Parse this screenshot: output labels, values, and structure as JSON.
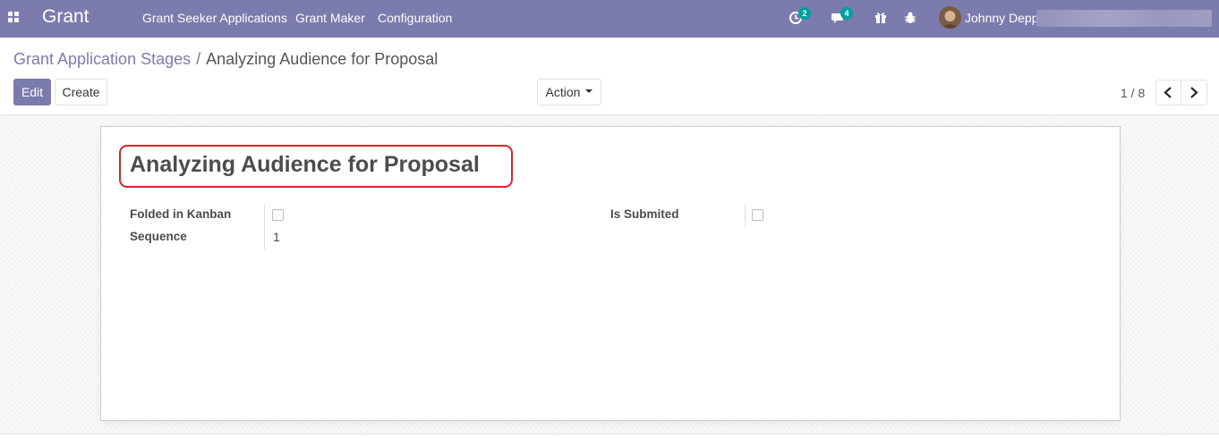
{
  "navbar": {
    "brand": "Grant",
    "menu": [
      "Grant Seeker Applications",
      "Grant Maker",
      "Configuration"
    ],
    "activity_count": "2",
    "messages_count": "4",
    "user_name": "Johnny Depp",
    "color": "#7c7bad"
  },
  "breadcrumb": {
    "parent": "Grant Application Stages",
    "separator": "/",
    "current": "Analyzing Audience for Proposal"
  },
  "buttons": {
    "edit": "Edit",
    "create": "Create",
    "action": "Action"
  },
  "pager": {
    "value": "1 / 8"
  },
  "record": {
    "title": "Analyzing Audience for Proposal",
    "fields": {
      "folded_label": "Folded in Kanban",
      "folded_value": false,
      "sequence_label": "Sequence",
      "sequence_value": "1",
      "submitted_label": "Is Submited",
      "submitted_value": false
    }
  },
  "icons": [
    "apps-icon",
    "activity-icon",
    "messages-icon",
    "gift-icon",
    "bug-icon",
    "chevron-left-icon",
    "chevron-right-icon"
  ],
  "colors": {
    "primary": "#7c7bad",
    "badge": "#00a09d",
    "highlight": "#d9242f"
  }
}
